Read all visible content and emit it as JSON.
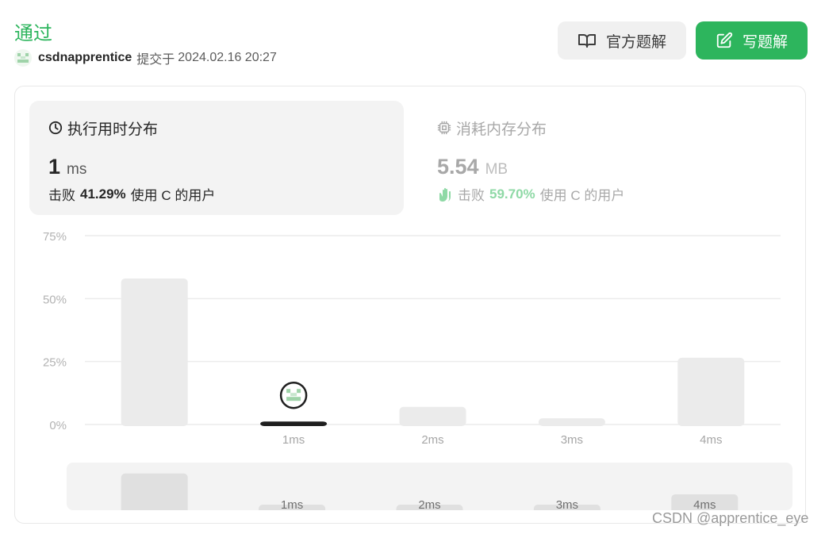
{
  "header": {
    "status": "通过",
    "username": "csdnapprentice",
    "submitted_prefix": "提交于",
    "submitted_time": "2024.02.16 20:27"
  },
  "buttons": {
    "official_solution": "官方题解",
    "write_solution": "写题解"
  },
  "runtime": {
    "title": "执行用时分布",
    "value": "1",
    "unit": "ms",
    "beats_prefix": "击败",
    "beats_percent": "41.29%",
    "beats_suffix": "使用 C 的用户"
  },
  "memory": {
    "title": "消耗内存分布",
    "value": "5.54",
    "unit": "MB",
    "beats_prefix": "击败",
    "beats_percent": "59.70%",
    "beats_suffix": "使用 C 的用户"
  },
  "colors": {
    "accent": "#2db55d",
    "bar": "#ebebeb",
    "bar_selected": "#1f1f1f",
    "overview_bar": "#e0e0e0"
  },
  "icons": {
    "runtime": "clock-icon",
    "memory": "chip-icon",
    "beats_memory": "clap-icon",
    "official": "book-icon",
    "write": "edit-icon"
  },
  "chart_data": {
    "type": "bar",
    "categories": [
      "",
      "1ms",
      "2ms",
      "3ms",
      "4ms"
    ],
    "values": [
      58,
      1.2,
      7,
      2.5,
      26.5
    ],
    "selected_index": 1,
    "ylim": [
      0,
      75
    ],
    "y_ticks": [
      "0%",
      "25%",
      "50%",
      "75%"
    ],
    "grid": true,
    "overview": {
      "categories": [
        "",
        "1ms",
        "2ms",
        "3ms",
        "4ms"
      ]
    }
  },
  "watermark": "CSDN @apprentice_eye"
}
